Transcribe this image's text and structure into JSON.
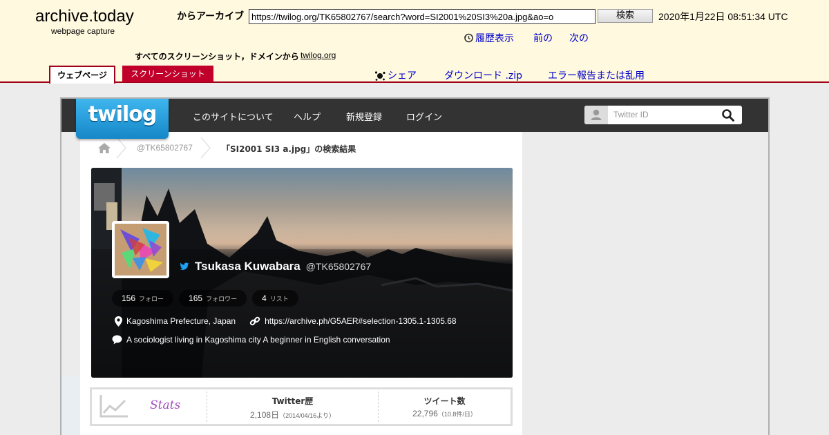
{
  "archive": {
    "logo": "archive.today",
    "subtitle": "webpage capture",
    "from_label": "からアーカイブ",
    "url": "https://twilog.org/TK65802767/search?word=SI2001%20SI3%20a.jpg&ao=o",
    "search_button": "検索",
    "timestamp": "2020年1月22日 08:51:34 UTC",
    "history_link": "履歴表示",
    "prev_link": "前の",
    "next_link": "次の",
    "all_screenshots": "すべてのスクリーンショット，ドメインから",
    "domain_link": "twilog.org",
    "tab_webpage": "ウェブページ",
    "tab_screenshot": "スクリーンショット",
    "share_link": "シェア",
    "download_link": "ダウンロード .zip",
    "report_link": "エラー報告または乱用"
  },
  "twilog": {
    "logo": "twilog",
    "nav": [
      "このサイトについて",
      "ヘルプ",
      "新規登録",
      "ログイン"
    ],
    "search_placeholder": "Twitter ID",
    "breadcrumb": {
      "user": "@TK65802767",
      "current": "「SI2001 SI3 a.jpg」の検索結果"
    },
    "profile": {
      "name": "Tsukasa Kuwabara",
      "screen_name": "@TK65802767",
      "follow_count": "156",
      "follow_label": "フォロー",
      "follower_count": "165",
      "follower_label": "フォロワー",
      "list_count": "4",
      "list_label": "リスト",
      "location": "Kagoshima Prefecture, Japan",
      "website": "https://archive.ph/G5AER#selection-1305.1-1305.68",
      "bio": "A sociologist living in Kagoshima city A beginner in English conversation"
    },
    "stats": {
      "label": "Stats",
      "history_heading": "Twitter歴",
      "history_value": "2,108日",
      "history_sub": "（2014/04/16より）",
      "tweets_heading": "ツイート数",
      "tweets_value": "22,796",
      "tweets_sub": "（10.8件/日）"
    }
  },
  "colors": {
    "archive_bg": "#fff9e0",
    "archive_accent": "#a00018",
    "link": "#0000cc",
    "twilog_blue": "#2a9fe0",
    "navbar": "#333333"
  }
}
